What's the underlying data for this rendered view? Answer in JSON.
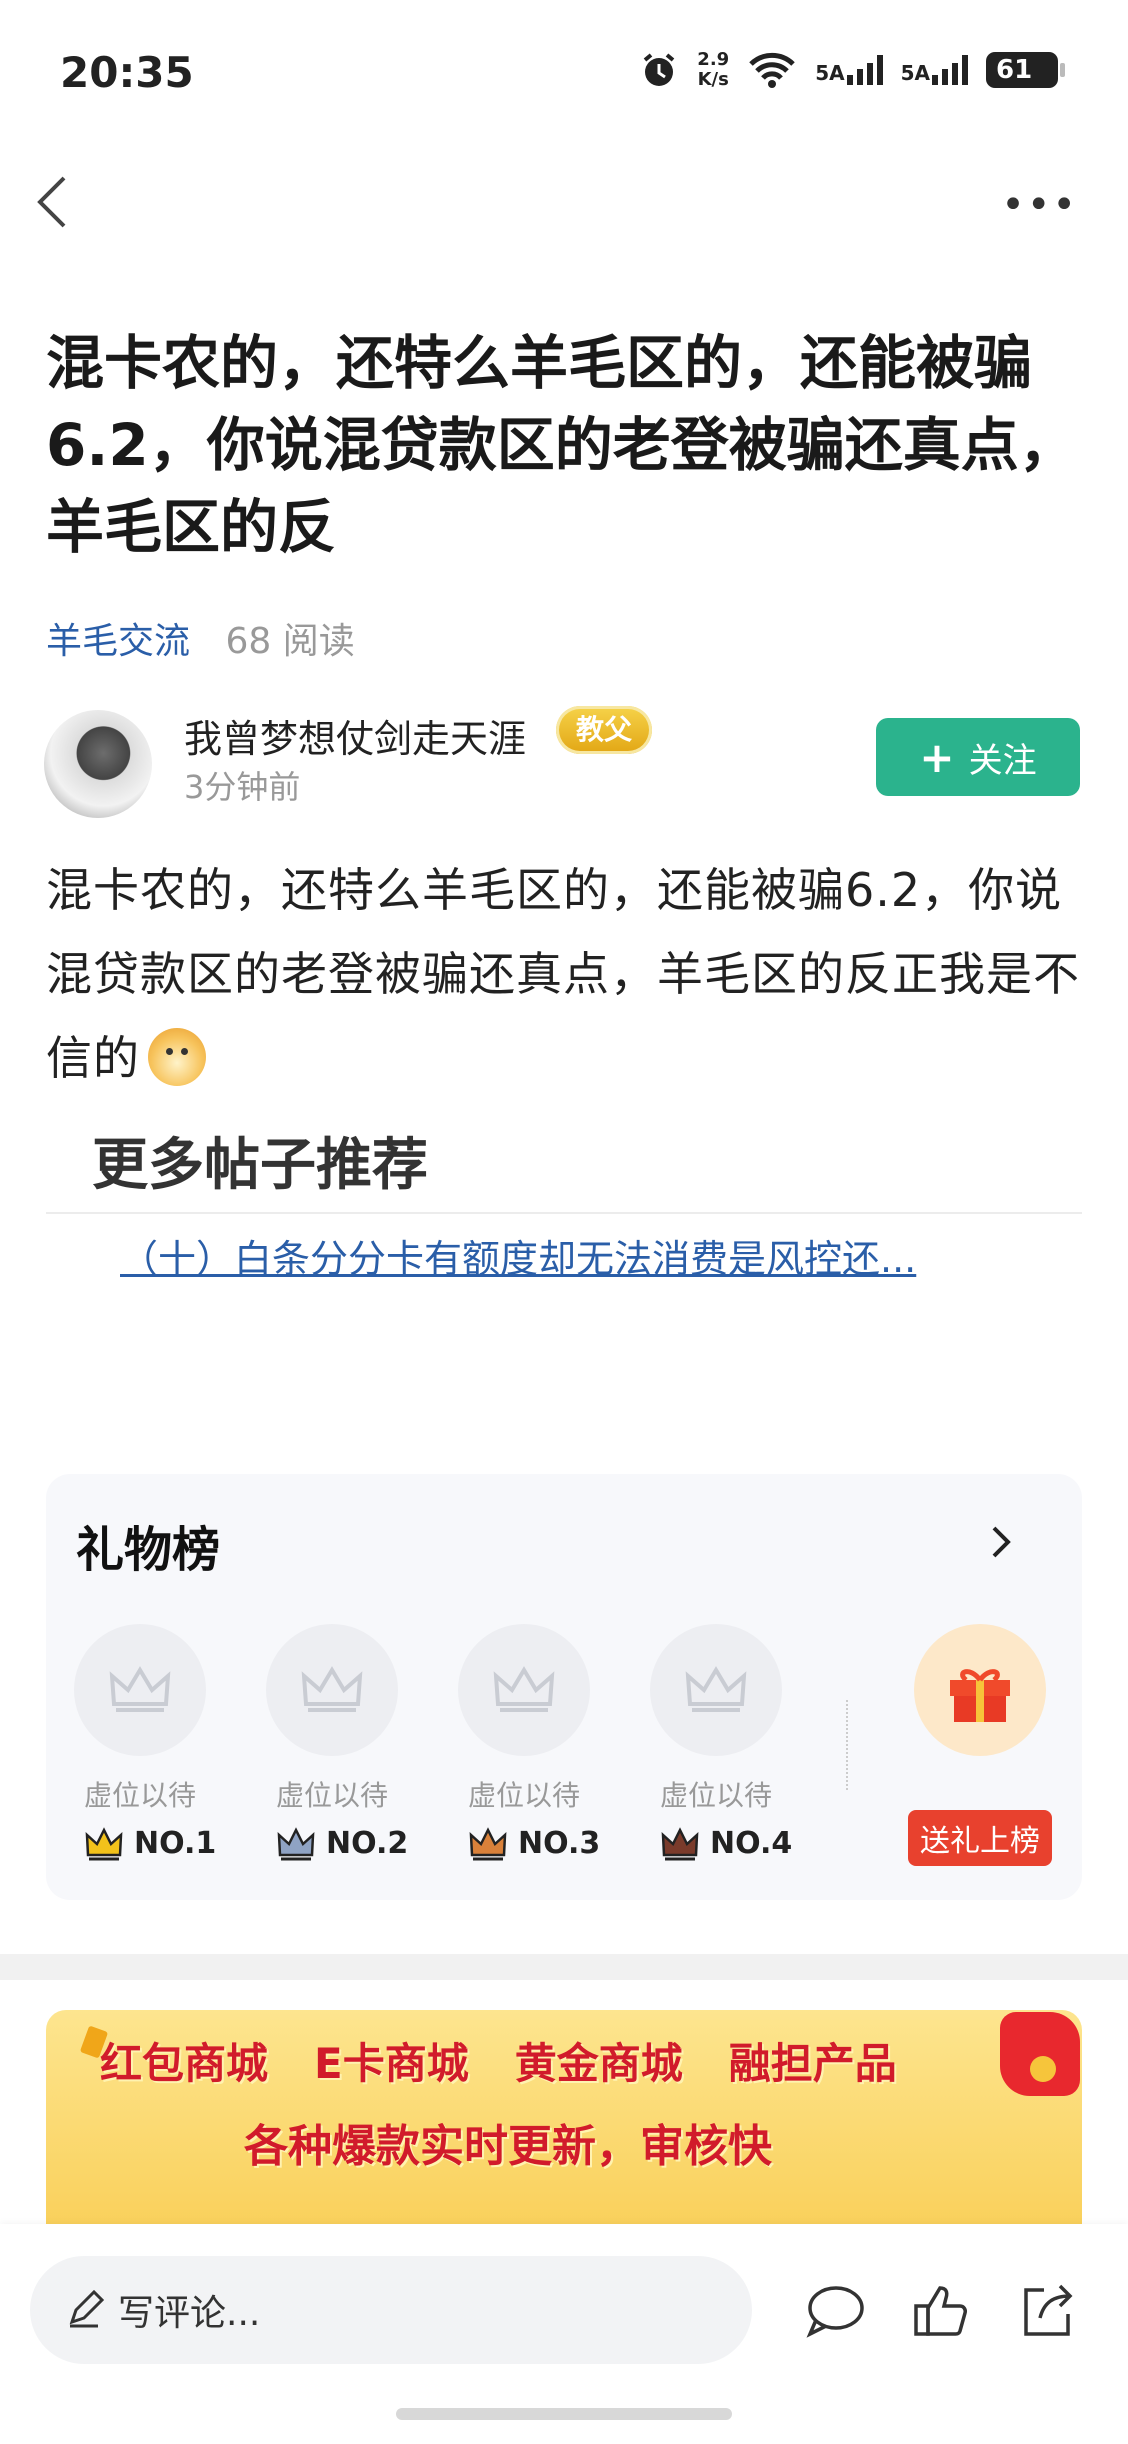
{
  "status_bar": {
    "time": "20:35",
    "net_speed_value": "2.9",
    "net_speed_unit": "K/s",
    "signal1": "5A",
    "signal2": "5A",
    "battery": "61"
  },
  "post": {
    "title": "混卡农的，还特么羊毛区的，还能被骗6.2，你说混贷款区的老登被骗还真点，羊毛区的反",
    "category": "羊毛交流",
    "reads": "68 阅读",
    "author_name": "我曾梦想仗剑走天涯",
    "author_badge": "教父",
    "post_time": "3分钟前",
    "follow_label": "关注",
    "body": "混卡农的，还特么羊毛区的，还能被骗6.2，你说混贷款区的老登被骗还真点，羊毛区的反正我是不信的"
  },
  "recommend": {
    "title": "更多帖子推荐",
    "link": "（十）白条分分卡有额度却无法消费是风控还..."
  },
  "gift_board": {
    "title": "礼物榜",
    "placeholder": "虚位以待",
    "ranks": [
      "NO.1",
      "NO.2",
      "NO.3",
      "NO.4"
    ],
    "rank_colors": [
      "#f2c21b",
      "#8fa3c4",
      "#d9813a",
      "#7a3b2b"
    ],
    "send_label": "送礼上榜"
  },
  "banner": {
    "items": [
      "红包商城",
      "E卡商城",
      "黄金商城",
      "融担产品"
    ],
    "subtitle": "各种爆款实时更新，审核快"
  },
  "bottom_bar": {
    "comment_placeholder": "写评论..."
  }
}
